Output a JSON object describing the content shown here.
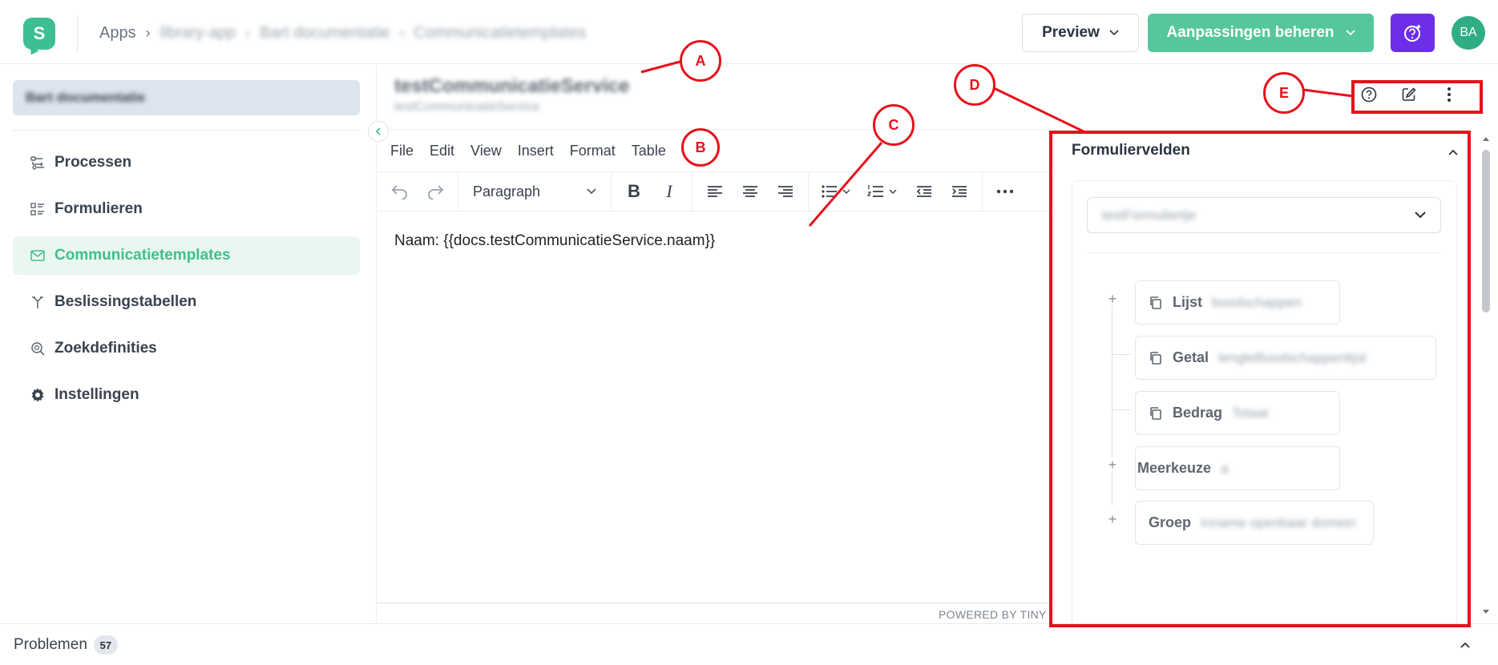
{
  "topbar": {
    "logo_letter": "S",
    "breadcrumb": [
      "Apps",
      "library-app",
      "Bart documentatie",
      "Communicatietemplates"
    ],
    "breadcrumb_sep": "›",
    "preview_label": "Preview",
    "manage_label": "Aanpassingen beheren",
    "avatar_initials": "BA"
  },
  "sidebar": {
    "project": "Bart documentatie",
    "items": [
      {
        "label": "Processen",
        "icon": "process-icon"
      },
      {
        "label": "Formulieren",
        "icon": "form-list-icon"
      },
      {
        "label": "Communicatietemplates",
        "icon": "mail-icon",
        "active": true
      },
      {
        "label": "Beslissingstabellen",
        "icon": "decision-icon"
      },
      {
        "label": "Zoekdefinities",
        "icon": "search-definition-icon"
      },
      {
        "label": "Instellingen",
        "icon": "gear-icon"
      }
    ]
  },
  "document": {
    "title": "testCommunicatieService",
    "subtitle": "testCommunicatieService"
  },
  "editor": {
    "menu": [
      "File",
      "Edit",
      "View",
      "Insert",
      "Format",
      "Table"
    ],
    "block_format": "Paragraph",
    "content": "Naam: {{docs.testCommunicatieService.naam}}",
    "powered_by": "POWERED BY TINY"
  },
  "panel": {
    "title": "Formuliervelden",
    "selected_form": "testFormuliertje",
    "fields": [
      {
        "type": "Lijst",
        "name": "boodschappen",
        "expandable": true,
        "copy_icon": true
      },
      {
        "type": "Getal",
        "name": "lengteBoodschappenlijst",
        "expandable": false,
        "copy_icon": true
      },
      {
        "type": "Bedrag",
        "name": "Totaal",
        "expandable": false,
        "copy_icon": true
      },
      {
        "type": "Meerkeuze",
        "name": "a",
        "expandable": true,
        "copy_icon": false
      },
      {
        "type": "Groep",
        "name": "Inname openbaar domein",
        "expandable": true,
        "copy_icon": false
      }
    ]
  },
  "bottombar": {
    "problems_label": "Problemen",
    "problems_count": "57"
  },
  "annotations": {
    "a": "A",
    "b": "B",
    "c": "C",
    "d": "D",
    "e": "E",
    "color": "#e8101b"
  },
  "colors": {
    "accent_green": "#3dbf93",
    "ai_purple": "#6c2ee8",
    "annotation_red": "#e8101b"
  }
}
